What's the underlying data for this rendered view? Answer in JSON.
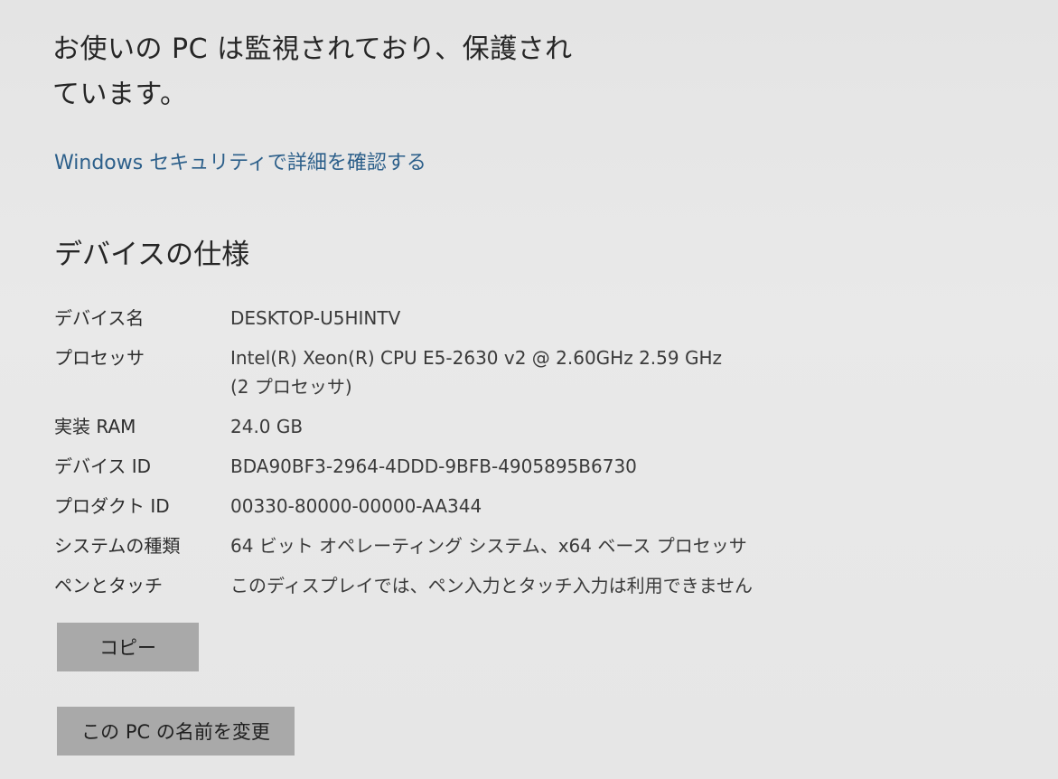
{
  "protection": {
    "status_text_line1": "お使いの PC は監視されており、保護され",
    "status_text_line2": "ています。",
    "security_link": "Windows セキュリティで詳細を確認する"
  },
  "device_specs": {
    "heading": "デバイスの仕様",
    "rows": [
      {
        "label": "デバイス名",
        "value": "DESKTOP-U5HINTV"
      },
      {
        "label": "プロセッサ",
        "value": "Intel(R) Xeon(R) CPU E5-2630 v2 @ 2.60GHz   2.59 GHz  (2 プロセッサ)"
      },
      {
        "label": "実装 RAM",
        "value": "24.0 GB"
      },
      {
        "label": "デバイス ID",
        "value": "BDA90BF3-2964-4DDD-9BFB-4905895B6730"
      },
      {
        "label": "プロダクト ID",
        "value": "00330-80000-00000-AA344"
      },
      {
        "label": "システムの種類",
        "value": "64 ビット オペレーティング システム、x64 ベース プロセッサ"
      },
      {
        "label": "ペンとタッチ",
        "value": "このディスプレイでは、ペン入力とタッチ入力は利用できません"
      }
    ],
    "copy_button": "コピー"
  },
  "rename_button": "この PC の名前を変更"
}
